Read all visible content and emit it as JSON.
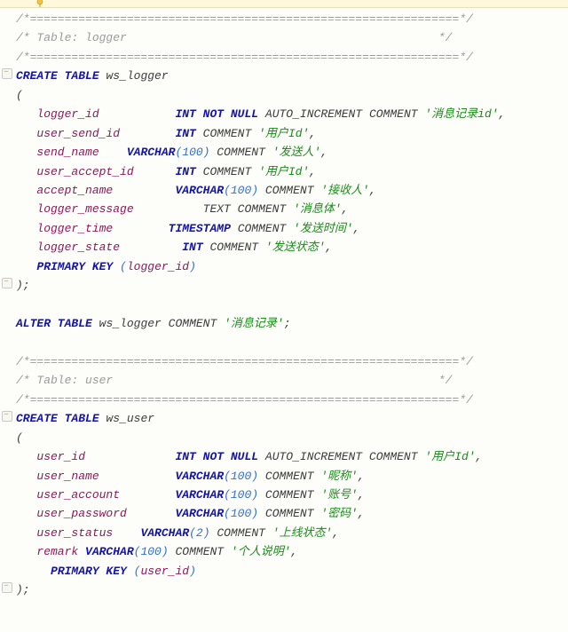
{
  "divider": "/*==============================================================*/",
  "tableComment1": "/* Table: logger                                             */",
  "tableComment2": "/* Table: user                                               */",
  "createTable": "CREATE TABLE",
  "alterTable": "ALTER TABLE",
  "int": "INT",
  "notNull": "NOT NULL",
  "autoInc": "AUTO_INCREMENT",
  "commentKw": "COMMENT",
  "varchar": "VARCHAR",
  "text": "TEXT",
  "timestamp": "TIMESTAMP",
  "primaryKey": "PRIMARY KEY",
  "logger": {
    "name": "ws_logger",
    "cols": {
      "c1": "logger_id",
      "c2": "user_send_id",
      "c3": "send_name",
      "c4": "user_accept_id",
      "c5": "accept_name",
      "c6": "logger_message",
      "c7": "logger_time",
      "c8": "logger_state"
    },
    "strs": {
      "s1": "'消息记录id'",
      "s2": "'用户Id'",
      "s3": "'发送人'",
      "s4": "'用户Id'",
      "s5": "'接收人'",
      "s6": "'消息体'",
      "s7": "'发送时间'",
      "s8": "'发送状态'",
      "tableComment": "'消息记录'"
    },
    "n100": "100"
  },
  "user": {
    "name": "ws_user",
    "cols": {
      "c1": "user_id",
      "c2": "user_name",
      "c3": "user_account",
      "c4": "user_password",
      "c5": "user_status",
      "c6": "remark"
    },
    "strs": {
      "s1": "'用户Id'",
      "s2": "'昵称'",
      "s3": "'账号'",
      "s4": "'密码'",
      "s5": "'上线状态'",
      "s6": "'个人说明'"
    },
    "n100": "100",
    "n2": "2"
  }
}
